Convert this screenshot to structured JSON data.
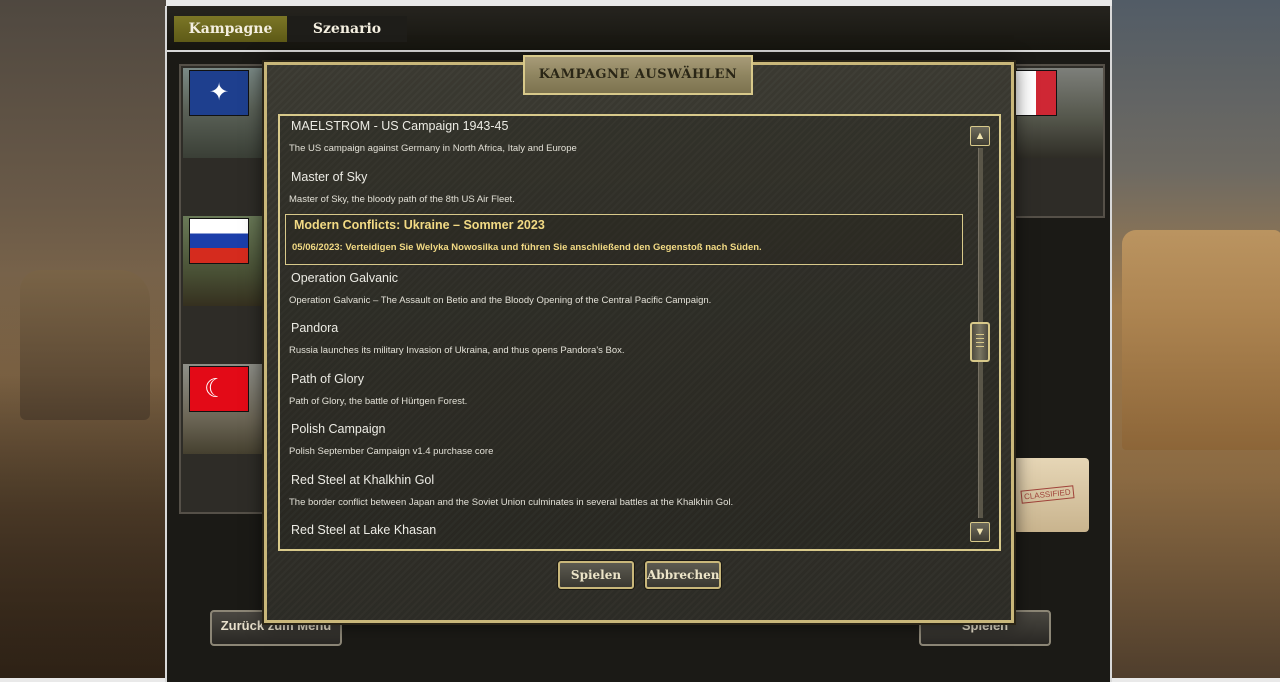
{
  "tabs": {
    "campaign_label": "Kampagne",
    "scenario_label": "Szenario"
  },
  "background": {
    "back_button_label": "Zurück zum Menü",
    "play_button_label": "Spielen",
    "folder_stamp": "CLASSIFIED"
  },
  "dialog": {
    "title": "KAMPAGNE AUSWÄHLEN",
    "play_label": "Spielen",
    "cancel_label": "Abbrechen",
    "campaigns": [
      {
        "name": "MAELSTROM - US Campaign 1943-45",
        "description": "The US campaign against Germany in North Africa, Italy and Europe",
        "selected": false
      },
      {
        "name": "Master of Sky",
        "description": "Master of Sky, the bloody path of the 8th US Air Fleet.",
        "selected": false
      },
      {
        "name": "Modern Conflicts: Ukraine – Sommer 2023",
        "description": "05/06/2023: Verteidigen Sie Welyka Nowosilka und führen Sie anschließend den Gegenstoß nach Süden.",
        "selected": true
      },
      {
        "name": "Operation Galvanic",
        "description": "Operation Galvanic – The Assault on Betio and the Bloody Opening of the Central Pacific Campaign.",
        "selected": false
      },
      {
        "name": "Pandora",
        "description": "Russia launches its military Invasion of Ukraina, and thus opens Pandora's Box.",
        "selected": false
      },
      {
        "name": "Path of Glory",
        "description": "Path of Glory, the battle of Hürtgen Forest.",
        "selected": false
      },
      {
        "name": "Polish Campaign",
        "description": "Polish September Campaign v1.4 purchase core",
        "selected": false
      },
      {
        "name": "Red Steel at Khalkhin Gol",
        "description": "The border conflict between Japan and the Soviet Union culminates in several battles at the Khalkhin Gol.",
        "selected": false
      },
      {
        "name": "Red Steel at Lake Khasan",
        "description": "",
        "selected": false
      }
    ]
  }
}
